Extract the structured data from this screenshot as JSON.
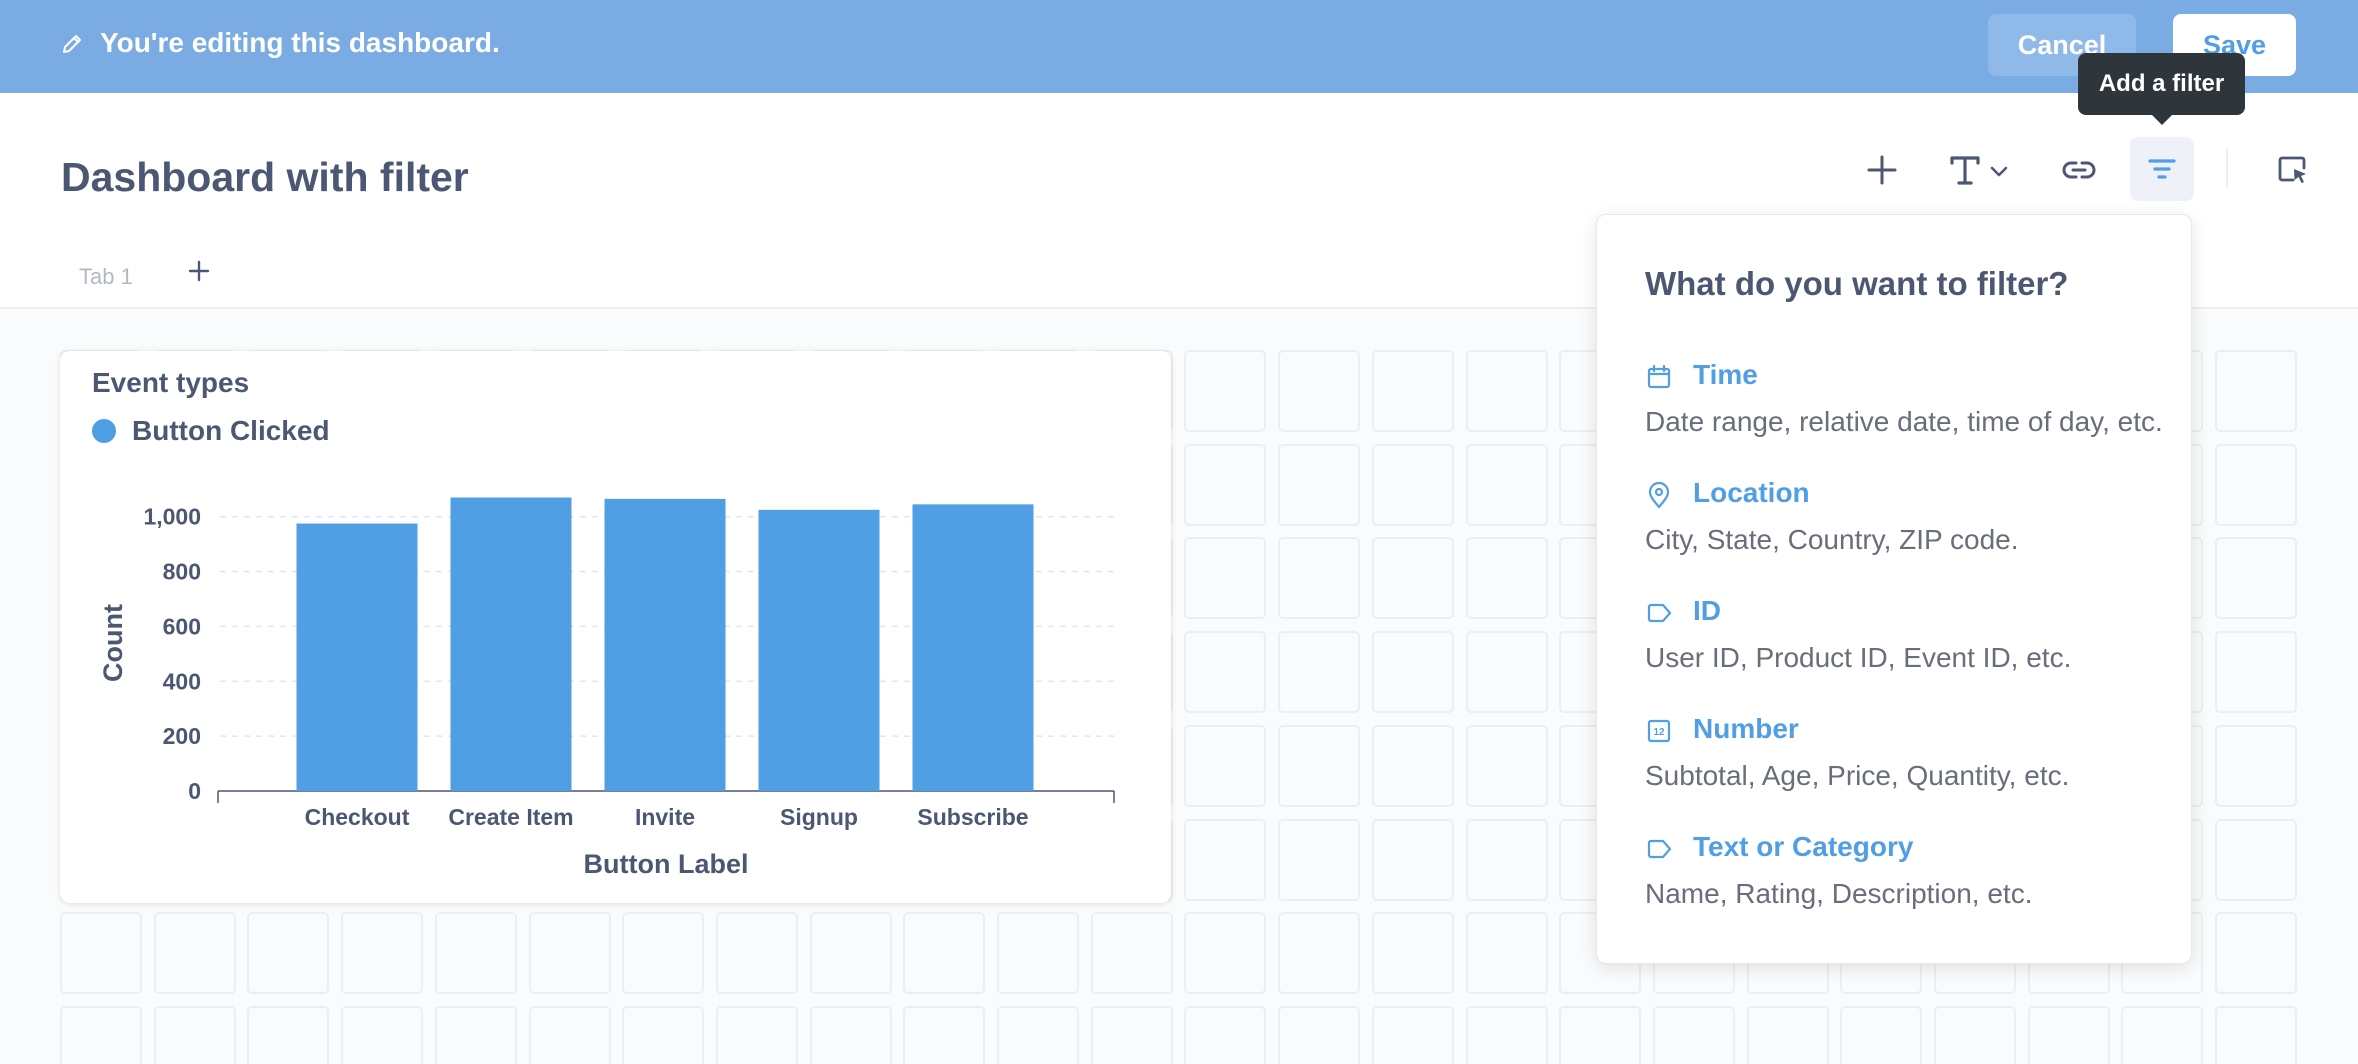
{
  "edit_bar": {
    "message": "You're editing this dashboard.",
    "cancel_label": "Cancel",
    "save_label": "Save"
  },
  "header": {
    "title": "Dashboard with filter",
    "tooltip": "Add a filter"
  },
  "tabs": [
    {
      "label": "Tab 1"
    }
  ],
  "card": {
    "title": "Event types",
    "legend": "Button Clicked",
    "colors": {
      "bar": "#509ee3"
    }
  },
  "chart_data": {
    "type": "bar",
    "title": "Event types",
    "xlabel": "Button Label",
    "ylabel": "Count",
    "categories": [
      "Checkout",
      "Create Item",
      "Invite",
      "Signup",
      "Subscribe"
    ],
    "series": [
      {
        "name": "Button Clicked",
        "values": [
          975,
          1070,
          1065,
          1025,
          1045
        ]
      }
    ],
    "ylim": [
      0,
      1000
    ],
    "yticks": [
      "0",
      "200",
      "400",
      "600",
      "800",
      "1,000"
    ],
    "grid": true,
    "legend_position": "top-left"
  },
  "filter_popover": {
    "title": "What do you want to filter?",
    "options": [
      {
        "label": "Time",
        "description": "Date range, relative date, time of day, etc.",
        "icon": "calendar-icon"
      },
      {
        "label": "Location",
        "description": "City, State, Country, ZIP code.",
        "icon": "location-pin-icon"
      },
      {
        "label": "ID",
        "description": "User ID, Product ID, Event ID, etc.",
        "icon": "tag-icon"
      },
      {
        "label": "Number",
        "description": "Subtotal, Age, Price, Quantity, etc.",
        "icon": "number-icon"
      },
      {
        "label": "Text or Category",
        "description": "Name, Rating, Description, etc.",
        "icon": "label-icon"
      }
    ]
  }
}
